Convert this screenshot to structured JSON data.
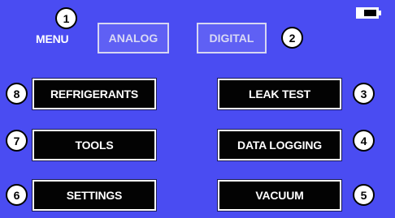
{
  "screen": {
    "menu_label": "MENU",
    "battery_icon": "battery-icon",
    "mode_tabs": [
      {
        "label": "ANALOG"
      },
      {
        "label": "DIGITAL"
      }
    ],
    "buttons": {
      "refrigerants": "REFRIGERANTS",
      "tools": "TOOLS",
      "settings": "SETTINGS",
      "leak_test": "LEAK TEST",
      "data_logging": "DATA LOGGING",
      "vacuum": "VACUUM"
    }
  },
  "callouts": [
    "1",
    "2",
    "3",
    "4",
    "5",
    "6",
    "7",
    "8"
  ],
  "colors": {
    "background": "#4a4cf2",
    "button": "#030303",
    "mode_tab": "#5f60f4"
  }
}
